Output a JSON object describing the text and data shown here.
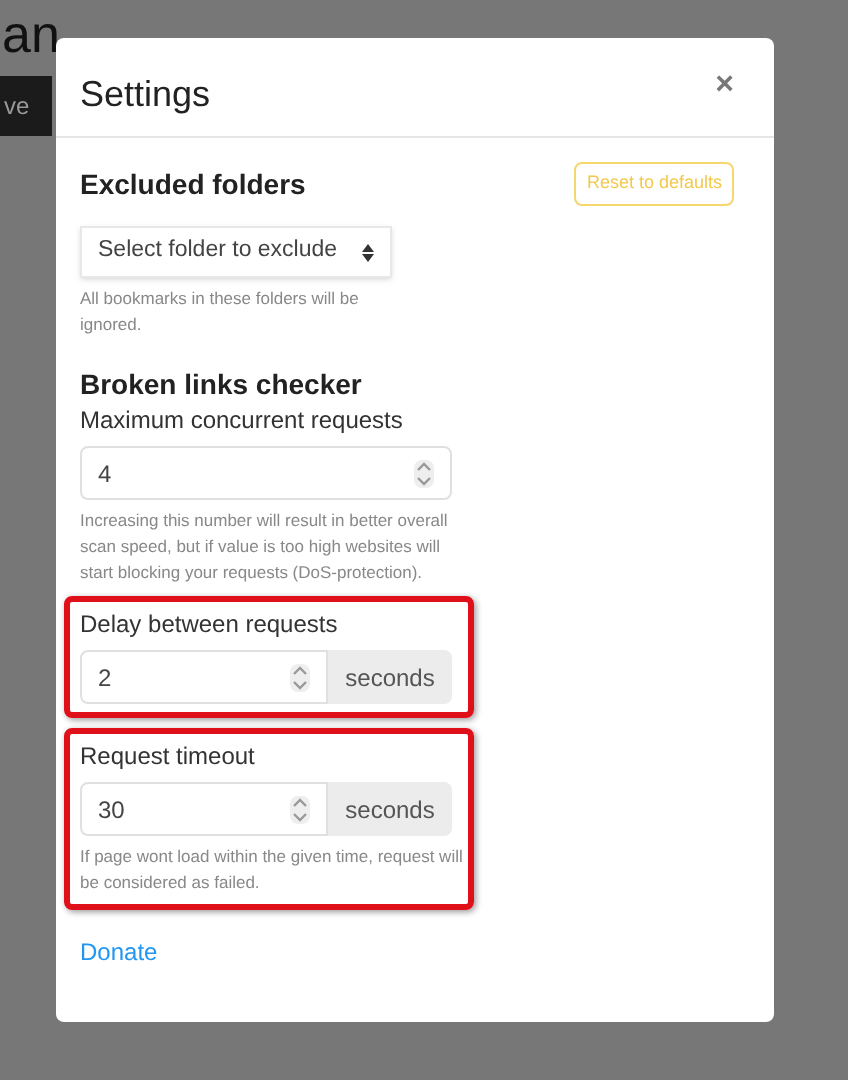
{
  "background_page": {
    "heading": "an",
    "button": "ve"
  },
  "dialog": {
    "title": "Settings",
    "close": "×",
    "excluded_folders": {
      "heading": "Excluded folders",
      "reset_button": "Reset to defaults",
      "select": "Select folder to exclude",
      "help": "All bookmarks in these folders will be ignored."
    },
    "broken_links": {
      "heading": "Broken links checker",
      "fields": [
        {
          "label": "Maximum concurrent requests",
          "value": "4",
          "help": "Increasing this number will result in better overall scan speed, but if value is too high websites will start blocking your requests (DoS-protection).",
          "highlighted": false
        },
        {
          "label": "Delay between requests",
          "value": "2",
          "unit": "seconds",
          "highlighted": true
        },
        {
          "label": "Request timeout",
          "value": "30",
          "unit": "seconds",
          "help": "If page wont load within the given time, request will be considered as failed.",
          "highlighted": true
        }
      ]
    },
    "donate_link": "Donate"
  }
}
